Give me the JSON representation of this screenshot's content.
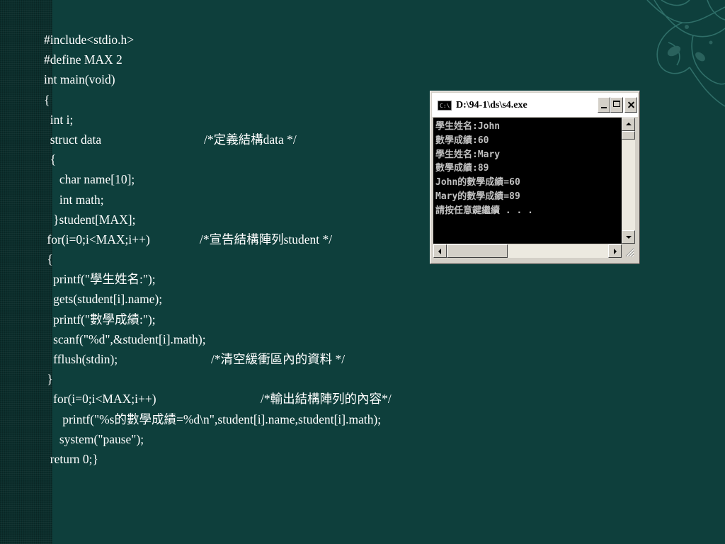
{
  "slide": {
    "code_lines": [
      {
        "code": "#include<stdio.h>",
        "comment": ""
      },
      {
        "code": "#define MAX 2",
        "comment": ""
      },
      {
        "code": "int main(void)",
        "comment": ""
      },
      {
        "code": "{",
        "comment": ""
      },
      {
        "code": "  int i;",
        "comment": ""
      },
      {
        "code": "  struct data",
        "comment": "/*定義結構data */"
      },
      {
        "code": "  {",
        "comment": ""
      },
      {
        "code": "     char name[10];",
        "comment": ""
      },
      {
        "code": "     int math;",
        "comment": ""
      },
      {
        "code": "   }student[MAX];",
        "comment": ""
      },
      {
        "code": " for(i=0;i<MAX;i++)",
        "comment": "/*宣告結構陣列student */"
      },
      {
        "code": " {",
        "comment": ""
      },
      {
        "code": "   printf(\"學生姓名:\");",
        "comment": ""
      },
      {
        "code": "   gets(student[i].name);",
        "comment": ""
      },
      {
        "code": "   printf(\"數學成績:\");",
        "comment": ""
      },
      {
        "code": "   scanf(\"%d\",&student[i].math);",
        "comment": ""
      },
      {
        "code": "   fflush(stdin);",
        "comment": "/*清空緩衝區內的資料 */"
      },
      {
        "code": " }",
        "comment": ""
      },
      {
        "code": "   for(i=0;i<MAX;i++)",
        "comment": "/*輸出結構陣列的內容*/"
      },
      {
        "code": "      printf(\"%s的數學成績=%d\\n\",student[i].name,student[i].math);",
        "comment": ""
      },
      {
        "code": "     system(\"pause\");",
        "comment": ""
      },
      {
        "code": "  return 0;}",
        "comment": ""
      }
    ]
  },
  "console_window": {
    "title": "D:\\94-1\\ds\\s4.exe",
    "system_icon_text": "C:\\",
    "output_lines": [
      "學生姓名:John",
      "數學成績:60",
      "學生姓名:Mary",
      "數學成績:89",
      "John的數學成績=60",
      "Mary的數學成績=89",
      "請按任意鍵繼續 . . ."
    ]
  },
  "icons": {
    "system_menu": "console-app-icon",
    "minimize": "minimize-icon",
    "maximize": "maximize-icon",
    "close": "close-icon",
    "ornament": "butterfly-ornament"
  },
  "colors": {
    "background": "#0e3f3c",
    "left_band": "#0b2e2c",
    "text": "#ffffff",
    "console_bg": "#000000",
    "console_text": "#c0c0c0"
  }
}
